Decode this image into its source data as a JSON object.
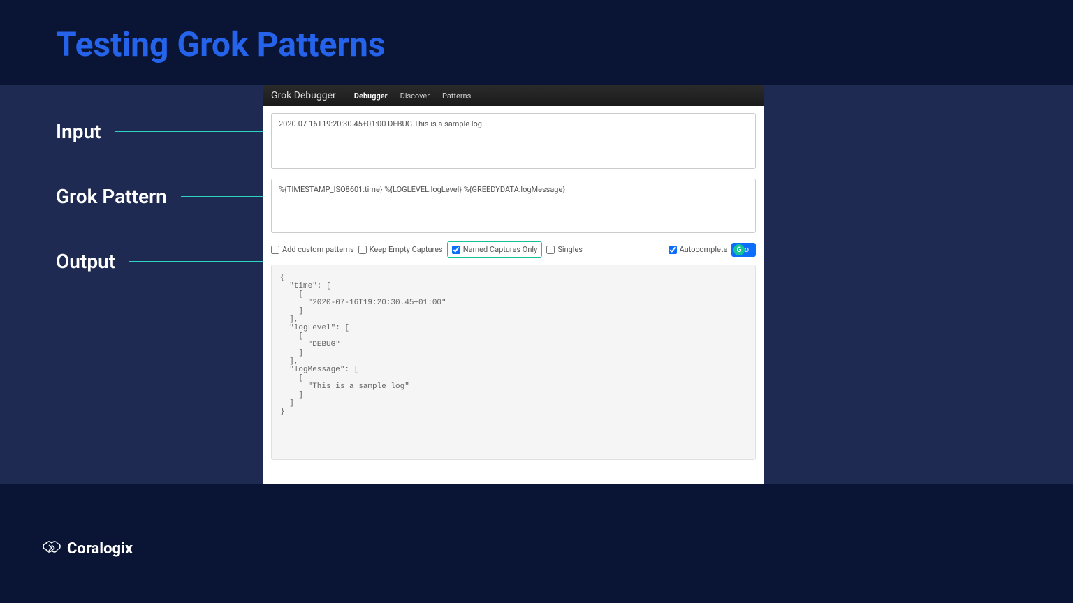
{
  "slide": {
    "title": "Testing Grok Patterns",
    "labels": {
      "input": "Input",
      "grok": "Grok Pattern",
      "output": "Output"
    }
  },
  "app": {
    "brand": "Grok Debugger",
    "tabs": [
      "Debugger",
      "Discover",
      "Patterns"
    ],
    "activeTab": 0,
    "inputValue": "2020-07-16T19:20:30.45+01:00 DEBUG This is a sample log",
    "patternValue": "%{TIMESTAMP_ISO8601:time} %{LOGLEVEL:logLevel} %{GREEDYDATA:logMessage}",
    "options": {
      "addCustom": {
        "label": "Add custom patterns",
        "checked": false
      },
      "keepEmpty": {
        "label": "Keep Empty Captures",
        "checked": false
      },
      "namedOnly": {
        "label": "Named Captures Only",
        "checked": true
      },
      "singles": {
        "label": "Singles",
        "checked": false
      },
      "autocomplete": {
        "label": "Autocomplete",
        "checked": true
      }
    },
    "goLabel": "Go",
    "output": "{\n  \"time\": [\n    [\n      \"2020-07-16T19:20:30.45+01:00\"\n    ]\n  ],\n  \"logLevel\": [\n    [\n      \"DEBUG\"\n    ]\n  ],\n  \"logMessage\": [\n    [\n      \"This is a sample log\"\n    ]\n  ]\n}"
  },
  "footer": {
    "brand": "Coralogix"
  }
}
